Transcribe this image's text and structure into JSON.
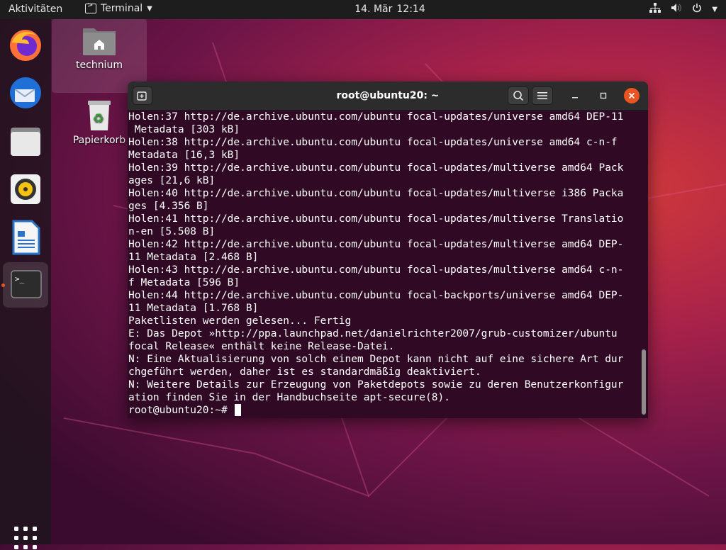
{
  "topbar": {
    "activities": "Aktivitäten",
    "app_name": "Terminal",
    "date": "14. Mär",
    "time": "12:14"
  },
  "dock": {
    "apps": [
      "firefox",
      "thunderbird",
      "files",
      "rhythmbox",
      "libreoffice-writer",
      "terminal"
    ]
  },
  "desktop": {
    "home_label": "technium",
    "trash_label": "Papierkorb"
  },
  "terminal": {
    "title": "root@ubuntu20: ~",
    "lines": [
      "Holen:37 http://de.archive.ubuntu.com/ubuntu focal-updates/universe amd64 DEP-11",
      " Metadata [303 kB]",
      "Holen:38 http://de.archive.ubuntu.com/ubuntu focal-updates/universe amd64 c-n-f",
      "Metadata [16,3 kB]",
      "Holen:39 http://de.archive.ubuntu.com/ubuntu focal-updates/multiverse amd64 Pack",
      "ages [21,6 kB]",
      "Holen:40 http://de.archive.ubuntu.com/ubuntu focal-updates/multiverse i386 Packa",
      "ges [4.356 B]",
      "Holen:41 http://de.archive.ubuntu.com/ubuntu focal-updates/multiverse Translatio",
      "n-en [5.508 B]",
      "Holen:42 http://de.archive.ubuntu.com/ubuntu focal-updates/multiverse amd64 DEP-",
      "11 Metadata [2.468 B]",
      "Holen:43 http://de.archive.ubuntu.com/ubuntu focal-updates/multiverse amd64 c-n-",
      "f Metadata [596 B]",
      "Holen:44 http://de.archive.ubuntu.com/ubuntu focal-backports/universe amd64 DEP-",
      "11 Metadata [1.768 B]",
      "Paketlisten werden gelesen... Fertig",
      "E: Das Depot »http://ppa.launchpad.net/danielrichter2007/grub-customizer/ubuntu",
      "focal Release« enthält keine Release-Datei.",
      "N: Eine Aktualisierung von solch einem Depot kann nicht auf eine sichere Art dur",
      "chgeführt werden, daher ist es standardmäßig deaktiviert.",
      "N: Weitere Details zur Erzeugung von Paketdepots sowie zu deren Benutzerkonfigur",
      "ation finden Sie in der Handbuchseite apt-secure(8)."
    ],
    "prompt": "root@ubuntu20:~# "
  },
  "colors": {
    "terminal_bg": "#300a24",
    "accent": "#e95420",
    "topbar_bg": "#1d1d1d"
  }
}
